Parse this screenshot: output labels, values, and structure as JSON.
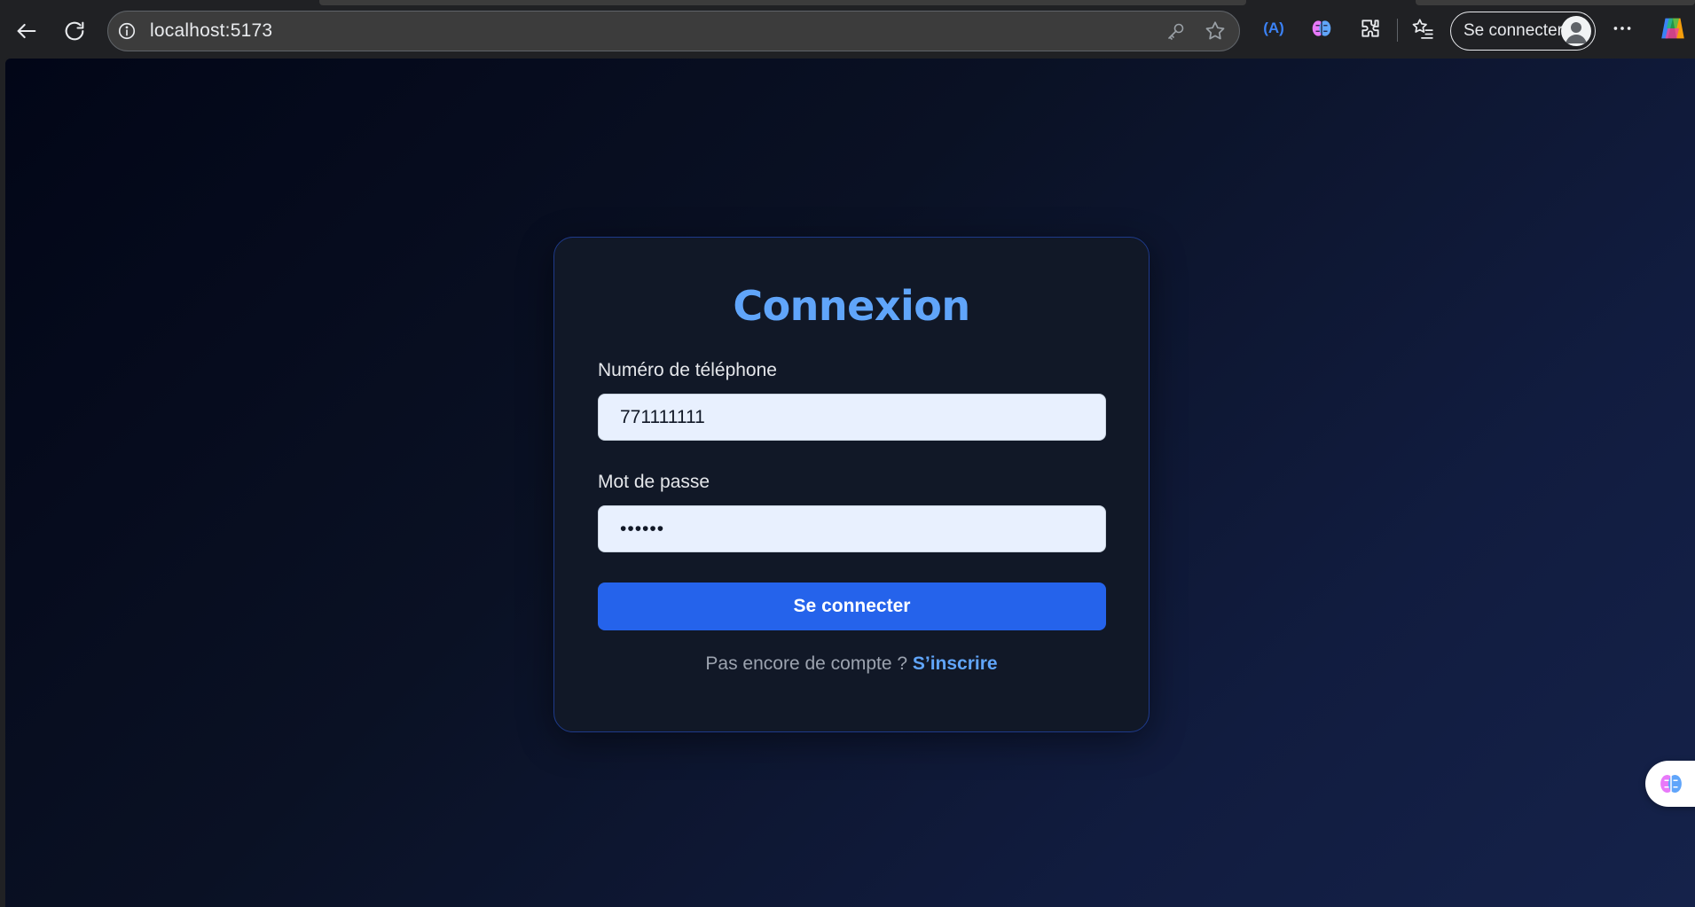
{
  "browser": {
    "url": "localhost:5173",
    "profile_button_label": "Se connecter",
    "ext_badge_text": "(A)",
    "icons": [
      "back-icon",
      "reload-icon",
      "site-info-icon",
      "password-key-icon",
      "favorite-star-icon",
      "read-aloud-icon",
      "brain-extension-icon",
      "extensions-puzzle-icon",
      "favorites-list-icon",
      "avatar-icon",
      "more-menu-icon",
      "copilot-icon"
    ]
  },
  "login": {
    "title": "Connexion",
    "phone_label": "Numéro de téléphone",
    "phone_value": "771111111",
    "password_label": "Mot de passe",
    "password_value": "••••••",
    "submit_label": "Se connecter",
    "signup_prompt": "Pas encore de compte ?",
    "signup_link": "S’inscrire"
  },
  "colors": {
    "accent": "#60a5fa",
    "button": "#2563eb",
    "card_bg": "#111827",
    "card_border": "#1e3a8a",
    "input_bg": "#e8f0fe"
  }
}
